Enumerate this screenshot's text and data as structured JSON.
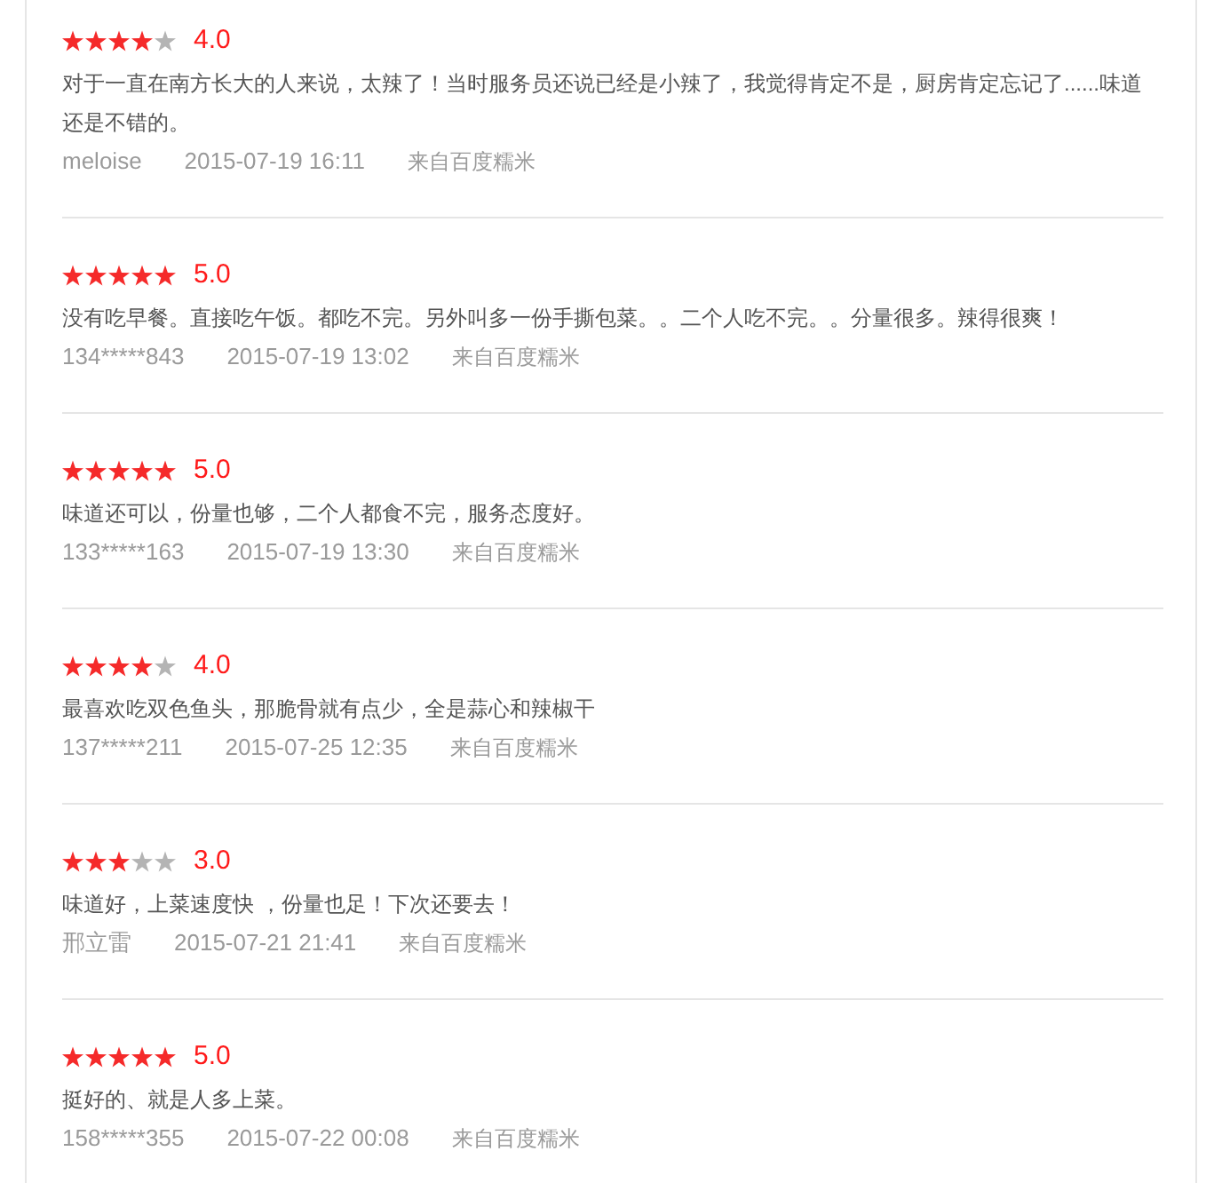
{
  "reviews": [
    {
      "stars": 4,
      "rating": "4.0",
      "text": "对于一直在南方长大的人来说，太辣了！当时服务员还说已经是小辣了，我觉得肯定不是，厨房肯定忘记了......味道还是不错的。",
      "author": "meloise",
      "time": "2015-07-19 16:11",
      "source": "来自百度糯米"
    },
    {
      "stars": 5,
      "rating": "5.0",
      "text": "没有吃早餐。直接吃午饭。都吃不完。另外叫多一份手撕包菜。。二个人吃不完。。分量很多。辣得很爽！",
      "author": "134*****843",
      "time": "2015-07-19 13:02",
      "source": "来自百度糯米"
    },
    {
      "stars": 5,
      "rating": "5.0",
      "text": "味道还可以，份量也够，二个人都食不完，服务态度好。",
      "author": "133*****163",
      "time": "2015-07-19 13:30",
      "source": "来自百度糯米"
    },
    {
      "stars": 4,
      "rating": "4.0",
      "text": "最喜欢吃双色鱼头，那脆骨就有点少，全是蒜心和辣椒干",
      "author": "137*****211",
      "time": "2015-07-25 12:35",
      "source": "来自百度糯米"
    },
    {
      "stars": 3,
      "rating": "3.0",
      "text": "味道好，上菜速度快 ，份量也足！下次还要去！",
      "author": "邢立雷",
      "time": "2015-07-21 21:41",
      "source": "来自百度糯米"
    },
    {
      "stars": 5,
      "rating": "5.0",
      "text": "挺好的、就是人多上菜。",
      "author": "158*****355",
      "time": "2015-07-22 00:08",
      "source": "来自百度糯米"
    }
  ]
}
